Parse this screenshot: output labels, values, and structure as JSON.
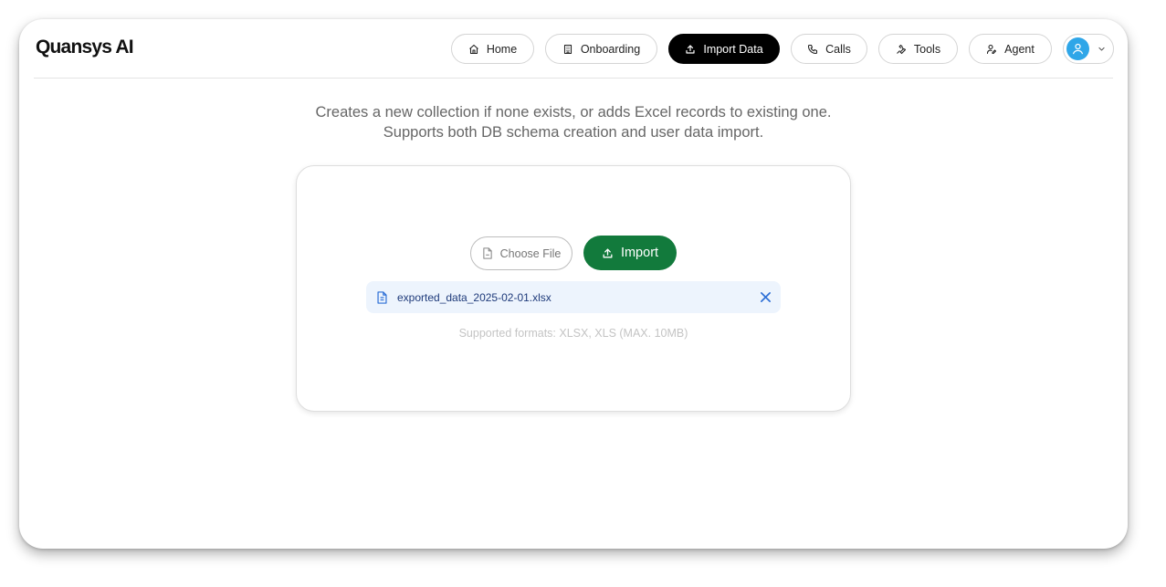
{
  "app": {
    "logo": "Quansys AI"
  },
  "nav": {
    "items": [
      {
        "label": "Home",
        "icon": "home-icon"
      },
      {
        "label": "Onboarding",
        "icon": "building-icon"
      },
      {
        "label": "Import Data",
        "icon": "upload-icon",
        "active": true
      },
      {
        "label": "Calls",
        "icon": "phone-icon"
      },
      {
        "label": "Tools",
        "icon": "wrench-icon"
      },
      {
        "label": "Agent",
        "icon": "user-edit-icon"
      }
    ],
    "user_menu": {
      "avatar_icon": "user-icon",
      "chevron_icon": "chevron-down-icon"
    }
  },
  "main": {
    "description_line1": "Creates a new collection if none exists, or adds Excel records to existing one.",
    "description_line2": "Supports both DB schema creation and user data import.",
    "choose_file_label": "Choose File",
    "import_label": "Import",
    "selected_file": "exported_data_2025-02-01.xlsx",
    "supported_formats": "Supported formats: XLSX, XLS (MAX. 10MB)"
  },
  "colors": {
    "accent_active_nav": "#000000",
    "import_button": "#127a3c",
    "file_chip_bg": "#edf4fd",
    "file_chip_text": "#1e3a7a",
    "avatar": "#2fa6e8",
    "remove_icon": "#2d6fd6"
  }
}
